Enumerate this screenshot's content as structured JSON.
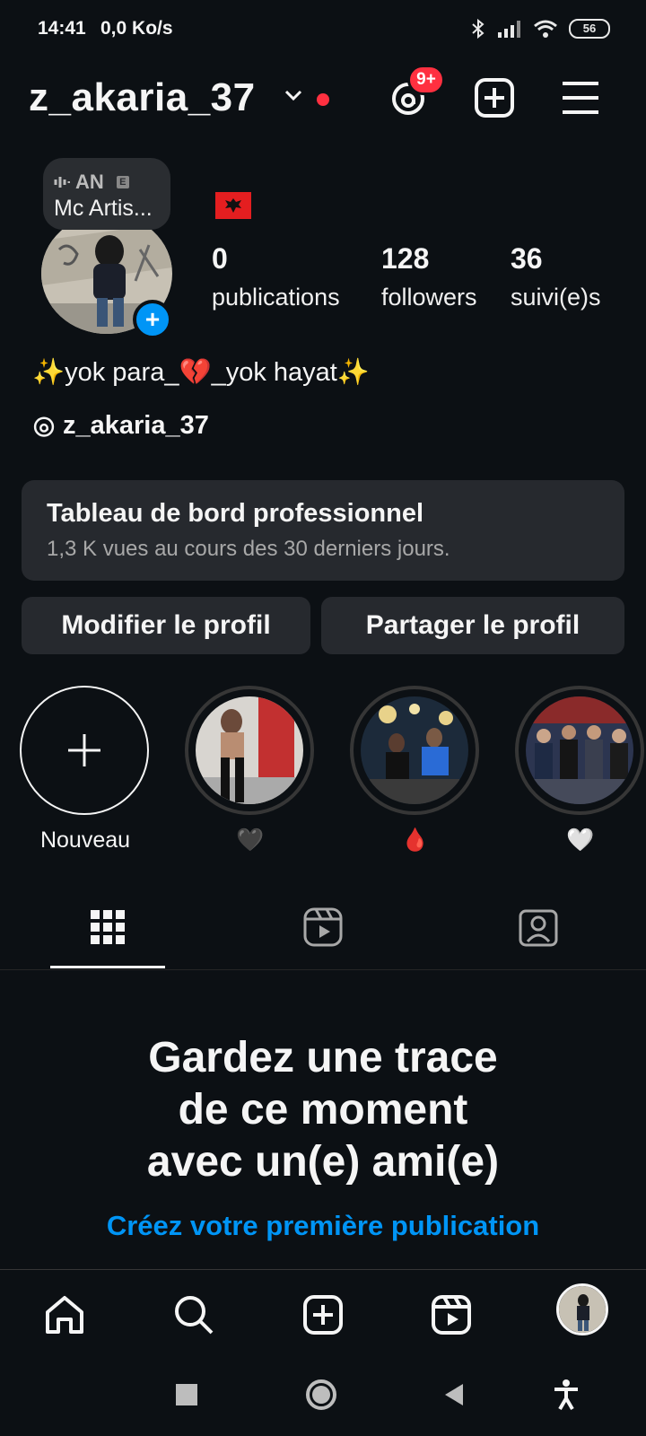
{
  "status_bar": {
    "time": "14:41",
    "network_speed": "0,0 Ko/s",
    "battery": "56"
  },
  "header": {
    "username": "z_akaria_37",
    "notifications_badge": "9+"
  },
  "note": {
    "line1": "AN",
    "line2": "Mc Artis..."
  },
  "profile": {
    "stats": [
      {
        "value": "0",
        "label": "publications"
      },
      {
        "value": "128",
        "label": "followers"
      },
      {
        "value": "36",
        "label": "suivi(e)s"
      }
    ],
    "bio": "✨yok para_💔_yok hayat✨",
    "threads_handle": "z_akaria_37"
  },
  "dashboard": {
    "title": "Tableau de bord professionnel",
    "subtitle": "1,3 K vues au cours des 30 derniers jours."
  },
  "buttons": {
    "edit": "Modifier le profil",
    "share": "Partager le profil"
  },
  "highlights": [
    {
      "label": "Nouveau"
    },
    {
      "label": "🖤"
    },
    {
      "label": "🩸"
    },
    {
      "label": "🤍"
    }
  ],
  "empty_state": {
    "line1": "Gardez une trace",
    "line2": "de ce moment",
    "line3": "avec un(e) ami(e)",
    "link": "Créez votre première publication"
  },
  "colors": {
    "background": "#0c1014",
    "accent": "#0095f6",
    "badge": "#ff3040",
    "card": "#26292e"
  }
}
